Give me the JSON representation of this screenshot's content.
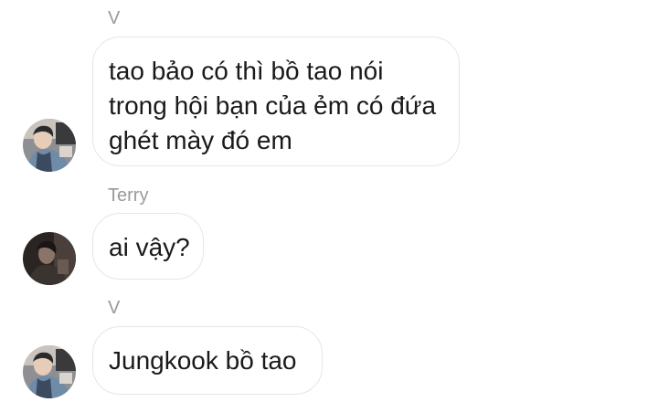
{
  "messages": [
    {
      "sender": "V",
      "avatar": "profile-photo",
      "lines": [
        "tao bảo có thì bồ tao nói",
        "trong hội bạn của ẻm có đứa",
        "ghét mày đó em"
      ]
    },
    {
      "sender": "Terry",
      "avatar": "profile-photo",
      "lines": [
        "ai vậy?"
      ]
    },
    {
      "sender": "V",
      "avatar": "profile-photo",
      "lines": [
        "Jungkook bồ tao"
      ]
    }
  ]
}
